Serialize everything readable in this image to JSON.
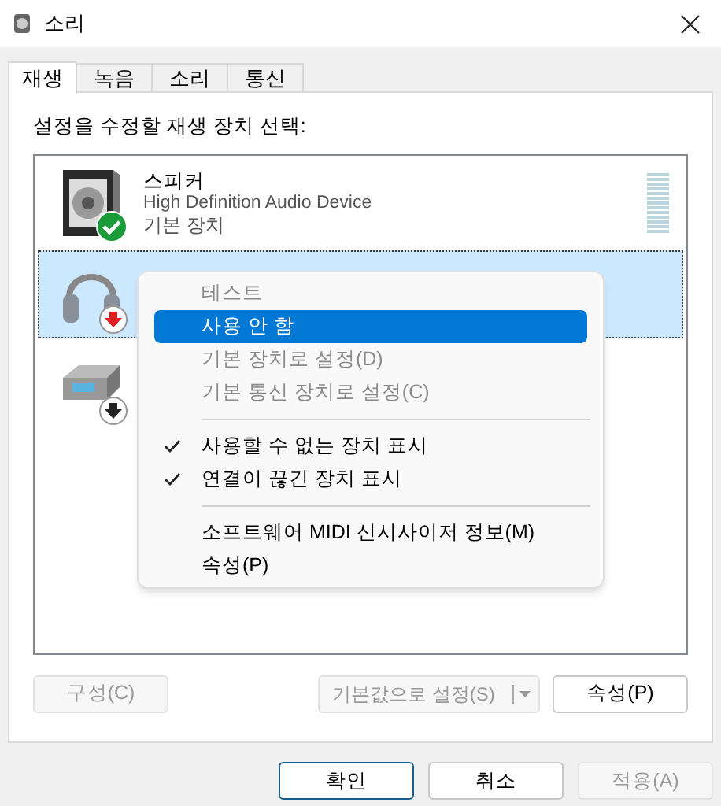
{
  "window": {
    "title": "소리"
  },
  "tabs": [
    {
      "label": "재생",
      "selected": true
    },
    {
      "label": "녹음",
      "selected": false
    },
    {
      "label": "소리",
      "selected": false
    },
    {
      "label": "통신",
      "selected": false
    }
  ],
  "instruction": "설정을 수정할 재생 장치 선택:",
  "devices": [
    {
      "kind": "speaker",
      "default": true,
      "disabled": false,
      "unplugged": false,
      "selected": false,
      "name": "스피커",
      "description": "High Definition Audio Device",
      "status": "기본 장치",
      "meter": true
    },
    {
      "kind": "headphones",
      "default": false,
      "disabled": true,
      "unplugged": false,
      "selected": true
    },
    {
      "kind": "receiver",
      "default": false,
      "disabled": false,
      "unplugged": true,
      "selected": false
    }
  ],
  "context_menu": [
    {
      "kind": "item",
      "label": "테스트",
      "disabled": true,
      "selected": false,
      "checked": false
    },
    {
      "kind": "item",
      "label": "사용 안 함",
      "disabled": false,
      "selected": true,
      "checked": false
    },
    {
      "kind": "item",
      "label": "기본 장치로 설정(D)",
      "disabled": true,
      "selected": false,
      "checked": false
    },
    {
      "kind": "item",
      "label": "기본 통신 장치로 설정(C)",
      "disabled": true,
      "selected": false,
      "checked": false
    },
    {
      "kind": "separator"
    },
    {
      "kind": "item",
      "label": "사용할 수 없는 장치 표시",
      "disabled": false,
      "selected": false,
      "checked": true
    },
    {
      "kind": "item",
      "label": "연결이 끊긴 장치 표시",
      "disabled": false,
      "selected": false,
      "checked": true
    },
    {
      "kind": "separator"
    },
    {
      "kind": "item",
      "label": "소프트웨어 MIDI 신시사이저 정보(M)",
      "disabled": false,
      "selected": false,
      "checked": false
    },
    {
      "kind": "item",
      "label": "속성(P)",
      "disabled": false,
      "selected": false,
      "checked": false
    }
  ],
  "panel_buttons": [
    {
      "label": "구성(C)",
      "disabled": true,
      "kind": "plain"
    },
    {
      "label": "기본값으로 설정(S)",
      "disabled": true,
      "kind": "split"
    },
    {
      "label": "속성(P)",
      "disabled": false,
      "kind": "plain"
    }
  ],
  "dialog_buttons": [
    {
      "label": "확인",
      "disabled": false,
      "default": true
    },
    {
      "label": "취소",
      "disabled": false,
      "default": false
    },
    {
      "label": "적용(A)",
      "disabled": true,
      "default": false
    }
  ]
}
